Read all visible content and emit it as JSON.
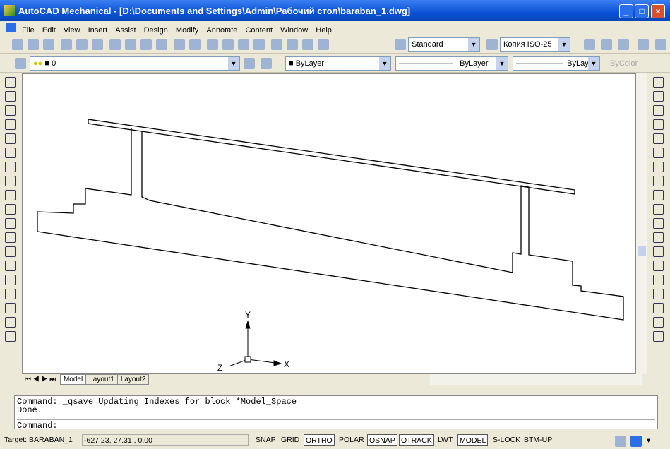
{
  "window": {
    "title": "AutoCAD Mechanical - [D:\\Documents and Settings\\Admin\\Рабочий стол\\baraban_1.dwg]",
    "minimize": "_",
    "maximize": "□",
    "close": "×"
  },
  "menu": [
    "File",
    "Edit",
    "View",
    "Insert",
    "Assist",
    "Design",
    "Modify",
    "Annotate",
    "Content",
    "Window",
    "Help"
  ],
  "toolbar": {
    "text_style": "Standard",
    "dim_style": "Копия ISO-25"
  },
  "layers": {
    "current_layer": "0",
    "color": "ByLayer",
    "linetype": "ByLayer",
    "lineweight": "ByLayer",
    "plot_style": "ByColor"
  },
  "ucs": {
    "x": "X",
    "y": "Y",
    "z": "Z"
  },
  "tabs": [
    "Model",
    "Layout1",
    "Layout2"
  ],
  "command": {
    "lines": [
      "Command: _qsave Updating Indexes for block *Model_Space",
      "Done."
    ],
    "prompt": "Command:"
  },
  "status": {
    "target": "Target: BARABAN_1",
    "coords": "-627.23, 27.31 , 0.00",
    "toggles": [
      {
        "label": "SNAP",
        "on": false
      },
      {
        "label": "GRID",
        "on": false
      },
      {
        "label": "ORTHO",
        "on": true
      },
      {
        "label": "POLAR",
        "on": false
      },
      {
        "label": "OSNAP",
        "on": true
      },
      {
        "label": "OTRACK",
        "on": true
      },
      {
        "label": "LWT",
        "on": false
      },
      {
        "label": "MODEL",
        "on": true
      },
      {
        "label": "S-LOCK",
        "on": false
      },
      {
        "label": "BTM-UP",
        "on": false
      }
    ]
  }
}
